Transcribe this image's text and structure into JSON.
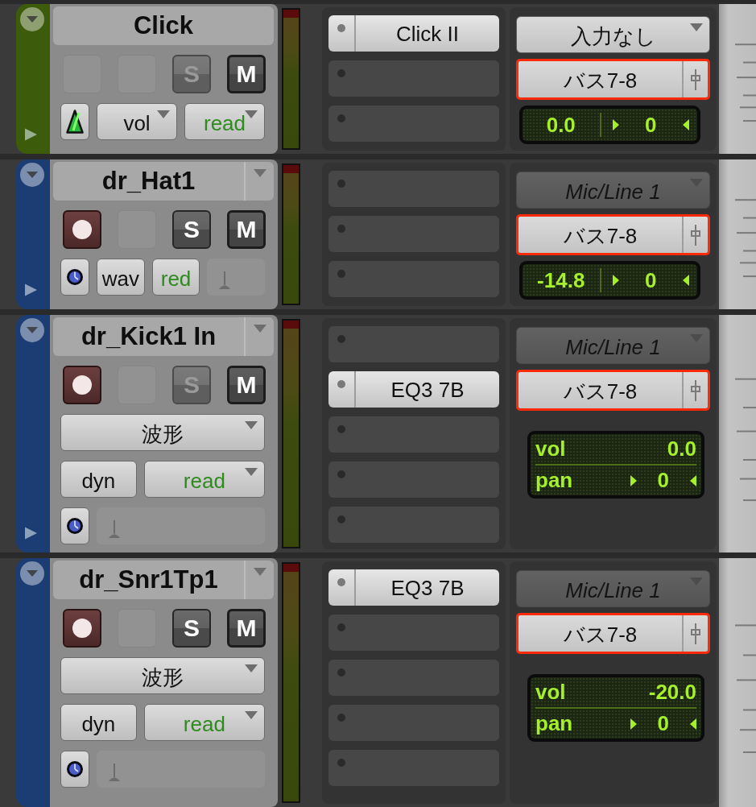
{
  "tracks": [
    {
      "name": "Click",
      "color": "#3d5c0b",
      "name_menu": false,
      "controls": [
        {
          "kind": "blank"
        },
        {
          "kind": "blank"
        },
        {
          "kind": "solo",
          "label": "S",
          "disabled": true
        },
        {
          "kind": "mute",
          "label": "M",
          "disabled": false
        }
      ],
      "rows": [
        [
          {
            "kind": "metronome"
          },
          {
            "kind": "menu",
            "label": "vol",
            "color": "#111111"
          },
          {
            "kind": "menu",
            "label": "read",
            "color": "#2e8b1e"
          }
        ]
      ],
      "inserts": [
        {
          "filled": true,
          "label": "Click II"
        },
        {
          "filled": false
        },
        {
          "filled": false
        }
      ],
      "input": {
        "label": "入力なし",
        "inactive": false
      },
      "output": {
        "label": "バス7-8",
        "highlighted": true
      },
      "display": {
        "kind": "compact",
        "volume": "0.0",
        "pan": "0"
      }
    },
    {
      "name": "dr_Hat1",
      "color": "#1c3d73",
      "name_menu": true,
      "controls": [
        {
          "kind": "record"
        },
        {
          "kind": "blank"
        },
        {
          "kind": "solo",
          "label": "S",
          "disabled": false
        },
        {
          "kind": "mute",
          "label": "M",
          "disabled": false
        }
      ],
      "rows": [
        [
          {
            "kind": "timebase"
          },
          {
            "kind": "button",
            "label": "wav",
            "color": "#111111"
          },
          {
            "kind": "button",
            "label": "red",
            "color": "#2e8b1e"
          },
          {
            "kind": "slot"
          }
        ]
      ],
      "inserts": [
        {
          "filled": false
        },
        {
          "filled": false
        },
        {
          "filled": false
        }
      ],
      "input": {
        "label": "Mic/Line 1",
        "inactive": true
      },
      "output": {
        "label": "バス7-8",
        "highlighted": true
      },
      "display": {
        "kind": "compact",
        "volume": "-14.8",
        "pan": "0"
      }
    },
    {
      "name": "dr_Kick1 In",
      "color": "#1c3d73",
      "name_menu": true,
      "controls": [
        {
          "kind": "record"
        },
        {
          "kind": "blank"
        },
        {
          "kind": "solo",
          "label": "S",
          "disabled": true
        },
        {
          "kind": "mute",
          "label": "M",
          "disabled": false
        }
      ],
      "rows": [
        [
          {
            "kind": "menu",
            "label": "波形",
            "color": "#111111"
          }
        ],
        [
          {
            "kind": "button",
            "label": "dyn",
            "color": "#111111"
          },
          {
            "kind": "menu",
            "label": "read",
            "color": "#2e8b1e"
          }
        ],
        [
          {
            "kind": "timebase"
          },
          {
            "kind": "slot"
          }
        ]
      ],
      "inserts": [
        {
          "filled": false
        },
        {
          "filled": true,
          "label": "EQ3 7B"
        },
        {
          "filled": false
        },
        {
          "filled": false
        },
        {
          "filled": false
        }
      ],
      "input": {
        "label": "Mic/Line 1",
        "inactive": true
      },
      "output": {
        "label": "バス7-8",
        "highlighted": true
      },
      "display": {
        "kind": "full",
        "volume_label": "vol",
        "volume": "0.0",
        "pan_label": "pan",
        "pan": "0"
      }
    },
    {
      "name": "dr_Snr1Tp1",
      "color": "#1c3d73",
      "name_menu": true,
      "controls": [
        {
          "kind": "record"
        },
        {
          "kind": "blank"
        },
        {
          "kind": "solo",
          "label": "S",
          "disabled": false
        },
        {
          "kind": "mute",
          "label": "M",
          "disabled": false
        }
      ],
      "rows": [
        [
          {
            "kind": "menu",
            "label": "波形",
            "color": "#111111"
          }
        ],
        [
          {
            "kind": "button",
            "label": "dyn",
            "color": "#111111"
          },
          {
            "kind": "menu",
            "label": "read",
            "color": "#2e8b1e"
          }
        ],
        [
          {
            "kind": "timebase"
          },
          {
            "kind": "slot"
          }
        ]
      ],
      "inserts": [
        {
          "filled": true,
          "label": "EQ3 7B"
        },
        {
          "filled": false
        },
        {
          "filled": false
        },
        {
          "filled": false
        },
        {
          "filled": false
        }
      ],
      "input": {
        "label": "Mic/Line 1",
        "inactive": true
      },
      "output": {
        "label": "バス7-8",
        "highlighted": true
      },
      "display": {
        "kind": "full",
        "volume_label": "vol",
        "volume": "-20.0",
        "pan_label": "pan",
        "pan": "0"
      }
    }
  ]
}
